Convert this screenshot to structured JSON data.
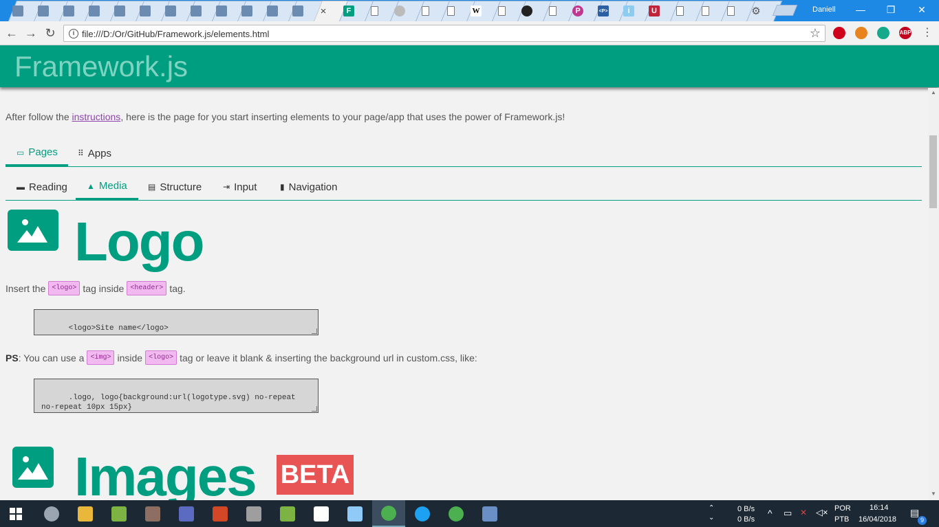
{
  "browser": {
    "user": "Daniell",
    "url": "file:///D:/Or/GitHub/Framework.js/elements.html",
    "tabs": [
      {
        "icon": "folder-icon"
      },
      {
        "icon": "folder-icon"
      },
      {
        "icon": "folder-icon"
      },
      {
        "icon": "folder-icon"
      },
      {
        "icon": "folder-icon"
      },
      {
        "icon": "folder-icon"
      },
      {
        "icon": "folder-icon"
      },
      {
        "icon": "folder-icon"
      },
      {
        "icon": "folder-icon"
      },
      {
        "icon": "folder-icon"
      },
      {
        "icon": "folder-icon"
      },
      {
        "icon": "folder-icon"
      },
      {
        "icon": "close-icon",
        "label": "×"
      },
      {
        "icon": "framework-icon",
        "label": "F"
      },
      {
        "icon": "document-icon"
      },
      {
        "icon": "disc-icon"
      },
      {
        "icon": "document-icon"
      },
      {
        "icon": "document-icon"
      },
      {
        "icon": "wikipedia-icon",
        "label": "W"
      },
      {
        "icon": "document-icon"
      },
      {
        "icon": "github-icon"
      },
      {
        "icon": "document-icon"
      },
      {
        "icon": "p-icon",
        "label": "P"
      },
      {
        "icon": "code-icon",
        "label": "<P>"
      },
      {
        "icon": "info-icon",
        "label": "i"
      },
      {
        "icon": "uc-icon",
        "label": "U"
      },
      {
        "icon": "document-icon"
      },
      {
        "icon": "document-icon"
      },
      {
        "icon": "document-icon"
      },
      {
        "icon": "settings-icon",
        "label": "⚙"
      }
    ],
    "window_controls": {
      "minimize": "—",
      "restore": "❐",
      "close": "✕"
    },
    "extensions": [
      {
        "name": "adobe-icon",
        "label": "",
        "color": "#d0021b"
      },
      {
        "name": "metamask-icon",
        "label": "",
        "color": "#e8831d"
      },
      {
        "name": "grammarly-icon",
        "label": "",
        "color": "#15a88a"
      },
      {
        "name": "adblock-icon",
        "label": "ABP",
        "color": "#c4001f"
      }
    ]
  },
  "page": {
    "brand": "Framework.js",
    "intro_before": "After follow the ",
    "intro_link": "instructions",
    "intro_after": ", here is the page for you start inserting elements to your page/app that uses the power of Framework.js!",
    "main_tabs": [
      {
        "label": "Pages",
        "icon": "pages-icon",
        "selected": true
      },
      {
        "label": "Apps",
        "icon": "apps-icon",
        "selected": false
      }
    ],
    "sub_tabs": [
      {
        "label": "Reading",
        "icon": "reading-icon",
        "selected": false
      },
      {
        "label": "Media",
        "icon": "image-icon",
        "selected": true
      },
      {
        "label": "Structure",
        "icon": "structure-icon",
        "selected": false
      },
      {
        "label": "Input",
        "icon": "input-icon",
        "selected": false
      },
      {
        "label": "Navigation",
        "icon": "navigation-icon",
        "selected": false
      }
    ],
    "logo_section": {
      "title": "Logo",
      "p1_before": "Insert the ",
      "p1_tag1": "<logo>",
      "p1_middle": " tag inside ",
      "p1_tag2": "<header>",
      "p1_after": " tag.",
      "code1": "<logo>Site name</logo>",
      "ps_label": "PS",
      "p2_before": ": You can use a ",
      "p2_tag1": "<img>",
      "p2_middle": "inside ",
      "p2_tag2": "<logo>",
      "p2_after": " tag or leave it blank & inserting the background url in custom.css, like:",
      "code2": ".logo, logo{background:url(logotype.svg) no-repeat no-repeat 10px 15px}"
    },
    "images_section": {
      "title": "Images",
      "badge": "BETA"
    }
  },
  "taskbar": {
    "apps": [
      "steam-icon",
      "file-explorer-icon",
      "notepadpp-icon",
      "paint-icon",
      "hwinfo-icon",
      "powerpoint-icon",
      "settings-gear-icon",
      "xtools-icon",
      "sticky-icon",
      "tool-icon",
      "chrome-icon",
      "twitter-icon",
      "chrome-alt-icon",
      "remote-icon"
    ],
    "net_up": "0 B/s",
    "net_down": "0 B/s",
    "lang1": "POR",
    "lang2": "PTB",
    "time": "16:14",
    "date": "16/04/2018",
    "notifications": "9"
  }
}
